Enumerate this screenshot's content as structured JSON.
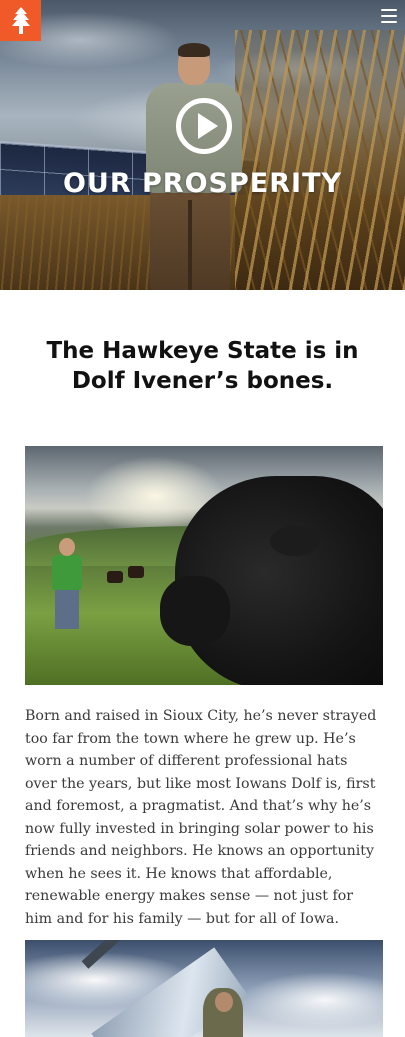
{
  "header": {
    "logo_icon": "tree-icon",
    "logo_color": "#f05a28",
    "menu_icon": "hamburger-menu-icon"
  },
  "hero": {
    "title": "OUR PROSPERITY",
    "play_icon": "play-icon"
  },
  "article": {
    "headline": "The Hawkeye State is in Dolf Ivener’s bones.",
    "body": "Born and raised in Sioux City, he’s never strayed too far from the town where he grew up. He’s worn a number of different professional hats over the years, but like most Iowans Dolf is, first and foremost, a pragmatist. And that’s why he’s now fully invested in bringing solar power to his friends and neighbors. He knows an opportunity when he sees it. He knows that affordable, renewable energy makes sense — not just for him and for his family — but for all of Iowa."
  }
}
